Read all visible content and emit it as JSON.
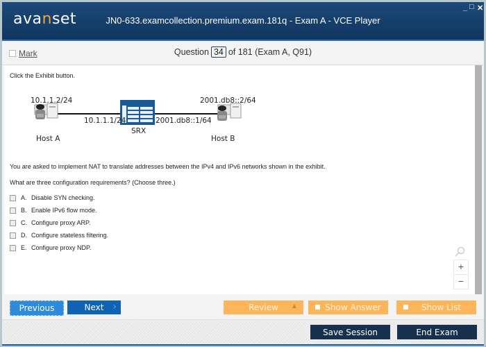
{
  "window": {
    "logo": {
      "prefix": "ava",
      "accent": "n",
      "suffix": "set"
    },
    "title": "JN0-633.examcollection.premium.exam.181q - Exam A - VCE Player",
    "controls": {
      "minimize": "_",
      "maximize": "□",
      "close": "✕"
    }
  },
  "question_bar": {
    "mark_label": "Mark",
    "question_prefix": "Question",
    "question_number": "34",
    "question_suffix": "of 181 (Exam A, Q91)"
  },
  "content": {
    "instruction": "Click the Exhibit button.",
    "exhibit": {
      "host_a_ip": "10.1.1.2/24",
      "host_a_label": "Host A",
      "srx_left_ip": "10.1.1.1/24",
      "srx_label": "SRX",
      "srx_right_ip": "2001.db8::1/64",
      "host_b_ip": "2001.db8::2/64",
      "host_b_label": "Host B"
    },
    "question_text": "You are asked to implement NAT to translate addresses between the IPv4 and IPv6 networks shown in the exhibit.",
    "question_prompt": "What are three configuration requirements? (Choose three.)",
    "options": [
      {
        "letter": "A.",
        "text": "Disable SYN checking.",
        "checked": false
      },
      {
        "letter": "B.",
        "text": "Enable IPv6 flow mode.",
        "checked": false
      },
      {
        "letter": "C.",
        "text": "Configure proxy ARP.",
        "checked": false
      },
      {
        "letter": "D.",
        "text": "Configure stateless filtering.",
        "checked": false
      },
      {
        "letter": "E.",
        "text": "Configure proxy NDP.",
        "checked": false
      }
    ],
    "zoom": {
      "zoom_in": "+",
      "zoom_out": "−"
    }
  },
  "nav": {
    "previous": "Previous",
    "next": "Next",
    "next_chevron": "›",
    "review": "Review",
    "review_arrow": "▲",
    "show_answer": "Show Answer",
    "show_list": "Show List"
  },
  "footer": {
    "save_session": "Save Session",
    "end_exam": "End Exam"
  },
  "colors": {
    "titlebar": "#0f3660",
    "primary_button": "#0e63b4",
    "accent_orange": "#fdb55a",
    "dark_button": "#16304d"
  }
}
